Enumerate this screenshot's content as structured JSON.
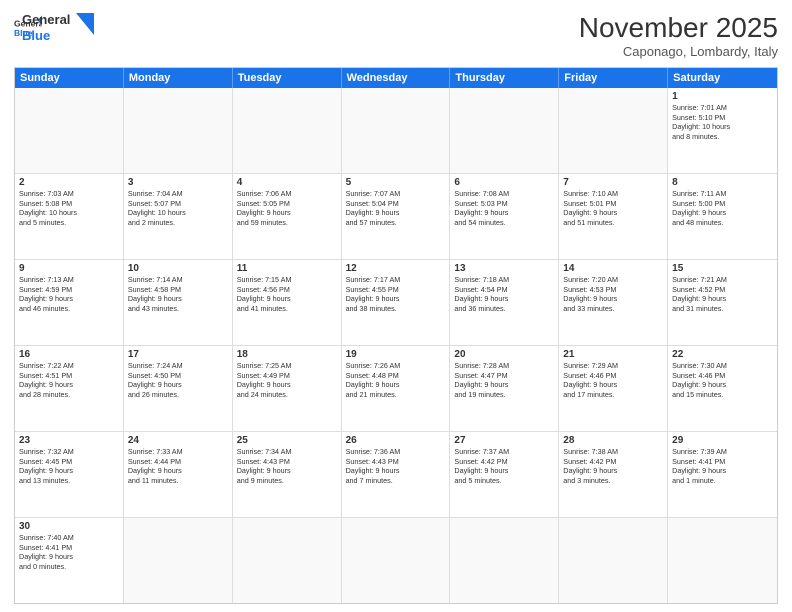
{
  "header": {
    "logo_general": "General",
    "logo_blue": "Blue",
    "month_title": "November 2025",
    "location": "Caponago, Lombardy, Italy"
  },
  "weekdays": [
    "Sunday",
    "Monday",
    "Tuesday",
    "Wednesday",
    "Thursday",
    "Friday",
    "Saturday"
  ],
  "rows": [
    [
      {
        "day": "",
        "text": ""
      },
      {
        "day": "",
        "text": ""
      },
      {
        "day": "",
        "text": ""
      },
      {
        "day": "",
        "text": ""
      },
      {
        "day": "",
        "text": ""
      },
      {
        "day": "",
        "text": ""
      },
      {
        "day": "1",
        "text": "Sunrise: 7:01 AM\nSunset: 5:10 PM\nDaylight: 10 hours\nand 8 minutes."
      }
    ],
    [
      {
        "day": "2",
        "text": "Sunrise: 7:03 AM\nSunset: 5:08 PM\nDaylight: 10 hours\nand 5 minutes."
      },
      {
        "day": "3",
        "text": "Sunrise: 7:04 AM\nSunset: 5:07 PM\nDaylight: 10 hours\nand 2 minutes."
      },
      {
        "day": "4",
        "text": "Sunrise: 7:06 AM\nSunset: 5:05 PM\nDaylight: 9 hours\nand 59 minutes."
      },
      {
        "day": "5",
        "text": "Sunrise: 7:07 AM\nSunset: 5:04 PM\nDaylight: 9 hours\nand 57 minutes."
      },
      {
        "day": "6",
        "text": "Sunrise: 7:08 AM\nSunset: 5:03 PM\nDaylight: 9 hours\nand 54 minutes."
      },
      {
        "day": "7",
        "text": "Sunrise: 7:10 AM\nSunset: 5:01 PM\nDaylight: 9 hours\nand 51 minutes."
      },
      {
        "day": "8",
        "text": "Sunrise: 7:11 AM\nSunset: 5:00 PM\nDaylight: 9 hours\nand 48 minutes."
      }
    ],
    [
      {
        "day": "9",
        "text": "Sunrise: 7:13 AM\nSunset: 4:59 PM\nDaylight: 9 hours\nand 46 minutes."
      },
      {
        "day": "10",
        "text": "Sunrise: 7:14 AM\nSunset: 4:58 PM\nDaylight: 9 hours\nand 43 minutes."
      },
      {
        "day": "11",
        "text": "Sunrise: 7:15 AM\nSunset: 4:56 PM\nDaylight: 9 hours\nand 41 minutes."
      },
      {
        "day": "12",
        "text": "Sunrise: 7:17 AM\nSunset: 4:55 PM\nDaylight: 9 hours\nand 38 minutes."
      },
      {
        "day": "13",
        "text": "Sunrise: 7:18 AM\nSunset: 4:54 PM\nDaylight: 9 hours\nand 36 minutes."
      },
      {
        "day": "14",
        "text": "Sunrise: 7:20 AM\nSunset: 4:53 PM\nDaylight: 9 hours\nand 33 minutes."
      },
      {
        "day": "15",
        "text": "Sunrise: 7:21 AM\nSunset: 4:52 PM\nDaylight: 9 hours\nand 31 minutes."
      }
    ],
    [
      {
        "day": "16",
        "text": "Sunrise: 7:22 AM\nSunset: 4:51 PM\nDaylight: 9 hours\nand 28 minutes."
      },
      {
        "day": "17",
        "text": "Sunrise: 7:24 AM\nSunset: 4:50 PM\nDaylight: 9 hours\nand 26 minutes."
      },
      {
        "day": "18",
        "text": "Sunrise: 7:25 AM\nSunset: 4:49 PM\nDaylight: 9 hours\nand 24 minutes."
      },
      {
        "day": "19",
        "text": "Sunrise: 7:26 AM\nSunset: 4:48 PM\nDaylight: 9 hours\nand 21 minutes."
      },
      {
        "day": "20",
        "text": "Sunrise: 7:28 AM\nSunset: 4:47 PM\nDaylight: 9 hours\nand 19 minutes."
      },
      {
        "day": "21",
        "text": "Sunrise: 7:29 AM\nSunset: 4:46 PM\nDaylight: 9 hours\nand 17 minutes."
      },
      {
        "day": "22",
        "text": "Sunrise: 7:30 AM\nSunset: 4:46 PM\nDaylight: 9 hours\nand 15 minutes."
      }
    ],
    [
      {
        "day": "23",
        "text": "Sunrise: 7:32 AM\nSunset: 4:45 PM\nDaylight: 9 hours\nand 13 minutes."
      },
      {
        "day": "24",
        "text": "Sunrise: 7:33 AM\nSunset: 4:44 PM\nDaylight: 9 hours\nand 11 minutes."
      },
      {
        "day": "25",
        "text": "Sunrise: 7:34 AM\nSunset: 4:43 PM\nDaylight: 9 hours\nand 9 minutes."
      },
      {
        "day": "26",
        "text": "Sunrise: 7:36 AM\nSunset: 4:43 PM\nDaylight: 9 hours\nand 7 minutes."
      },
      {
        "day": "27",
        "text": "Sunrise: 7:37 AM\nSunset: 4:42 PM\nDaylight: 9 hours\nand 5 minutes."
      },
      {
        "day": "28",
        "text": "Sunrise: 7:38 AM\nSunset: 4:42 PM\nDaylight: 9 hours\nand 3 minutes."
      },
      {
        "day": "29",
        "text": "Sunrise: 7:39 AM\nSunset: 4:41 PM\nDaylight: 9 hours\nand 1 minute."
      }
    ],
    [
      {
        "day": "30",
        "text": "Sunrise: 7:40 AM\nSunset: 4:41 PM\nDaylight: 9 hours\nand 0 minutes."
      },
      {
        "day": "",
        "text": ""
      },
      {
        "day": "",
        "text": ""
      },
      {
        "day": "",
        "text": ""
      },
      {
        "day": "",
        "text": ""
      },
      {
        "day": "",
        "text": ""
      },
      {
        "day": "",
        "text": ""
      }
    ]
  ]
}
